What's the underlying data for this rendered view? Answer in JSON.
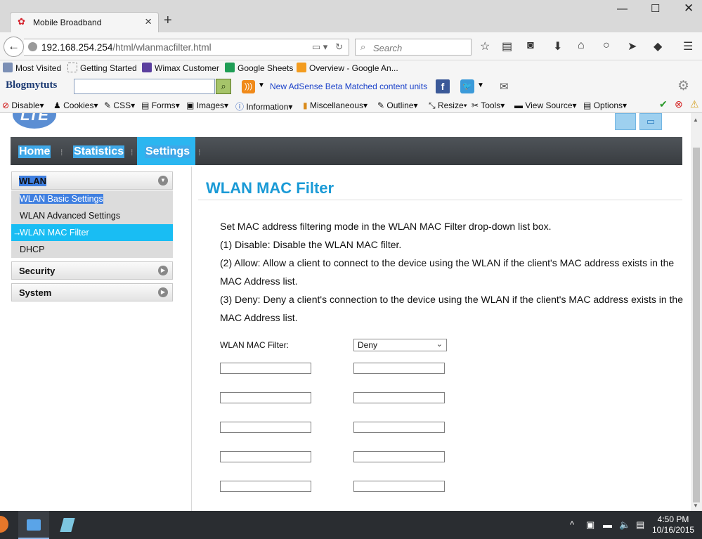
{
  "browser": {
    "tab_title": "Mobile Broadband",
    "url_host": "192.168.254.254",
    "url_path": "/html/wlanmacfilter.html",
    "search_placeholder": "Search",
    "bookmarks": [
      "Most Visited",
      "Getting Started",
      "Wimax Customer",
      "Google Sheets",
      "Overview - Google An..."
    ],
    "addon_brand": "Blogmytuts",
    "addon_link": "New AdSense Beta Matched content units",
    "webdev_items": [
      "Disable",
      "Cookies",
      "CSS",
      "Forms",
      "Images",
      "Information",
      "Miscellaneous",
      "Outline",
      "Resize",
      "Tools",
      "View Source",
      "Options"
    ]
  },
  "router": {
    "logo_text": "LTE",
    "menu": [
      "Home",
      "Statistics",
      "Settings"
    ],
    "sidebar": {
      "wlan_label": "WLAN",
      "wlan_items": [
        "WLAN Basic Settings",
        "WLAN Advanced Settings",
        "WLAN MAC Filter",
        "DHCP"
      ],
      "security_label": "Security",
      "system_label": "System"
    },
    "page_title": "WLAN MAC Filter",
    "description": [
      "Set MAC address filtering mode in the WLAN MAC Filter drop-down list box.",
      "(1) Disable: Disable the WLAN MAC filter.",
      "(2) Allow: Allow a client to connect to the device using the WLAN if the client's MAC address exists in the MAC Address list.",
      "(3) Deny: Deny a client's connection to the device using the WLAN if the client's MAC address exists in the MAC Address list."
    ],
    "filter_label": "WLAN MAC Filter:",
    "filter_value": "Deny",
    "mac_addresses": [
      "",
      "",
      "",
      "",
      "",
      "",
      "",
      "",
      "",
      ""
    ]
  },
  "taskbar": {
    "time": "4:50 PM",
    "date": "10/16/2015"
  },
  "colors": {
    "accent": "#1a9ad6",
    "active_menu": "#2bb6f0",
    "menubar": "#43474c"
  }
}
